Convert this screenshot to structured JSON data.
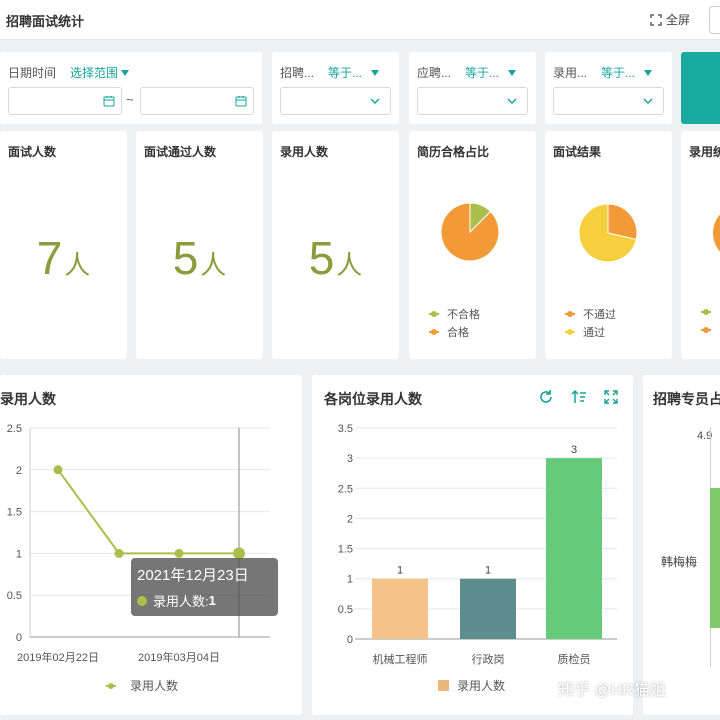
{
  "header": {
    "title": "招聘面试统计",
    "fullscreen_label": "全屏"
  },
  "filters": {
    "date": {
      "label": "日期时间",
      "mode": "选择范围",
      "separator": "~"
    },
    "recruiter": {
      "label": "招聘...",
      "operator": "等于..."
    },
    "applicant": {
      "label": "应聘...",
      "operator": "等于..."
    },
    "hire": {
      "label": "录用...",
      "operator": "等于..."
    }
  },
  "stats": [
    {
      "title": "面试人数",
      "value": "7",
      "unit": "人"
    },
    {
      "title": "面试通过人数",
      "value": "5",
      "unit": "人"
    },
    {
      "title": "录用人数",
      "value": "5",
      "unit": "人"
    }
  ],
  "pie_cards": [
    {
      "title": "简历合格占比",
      "legend": [
        "不合格",
        "合格"
      ]
    },
    {
      "title": "面试结果",
      "legend": [
        "不通过",
        "通过"
      ]
    },
    {
      "title": "录用统"
    }
  ],
  "colors": {
    "accent": "#17a398",
    "green_line": "#a9bf4a",
    "orange": "#f29a38",
    "yellow": "#f6cf3f",
    "bar_green": "#67c97a",
    "bar_teal": "#5d8e8d",
    "bar_peach": "#f5c28a"
  },
  "line_card": {
    "title": "录用人数",
    "legend": "录用人数"
  },
  "tooltip": {
    "date": "2021年12月23日",
    "series": "录用人数:",
    "value": "1"
  },
  "bar_card": {
    "title": "各岗位录用人数",
    "legend": "录用人数"
  },
  "side_card": {
    "title": "招聘专员占",
    "value_label": "4.9",
    "person": "韩梅梅"
  },
  "watermark": "知乎 @HR猫姐",
  "chart_data": [
    {
      "type": "pie",
      "title": "简历合格占比",
      "labels": [
        "不合格",
        "合格"
      ],
      "values": [
        1,
        7
      ]
    },
    {
      "type": "pie",
      "title": "面试结果",
      "labels": [
        "不通过",
        "通过"
      ],
      "values": [
        2,
        5
      ]
    },
    {
      "type": "line",
      "title": "录用人数",
      "x_ticks": [
        "2019年02月22日",
        "2019年03月04日"
      ],
      "points": [
        2,
        1,
        1,
        1
      ],
      "ylim": [
        0,
        2.5
      ],
      "y_ticks": [
        "0",
        "0.5",
        "1",
        "1.5",
        "2",
        "2.5"
      ],
      "series": [
        {
          "name": "录用人数",
          "values": [
            2,
            1,
            1,
            1
          ]
        }
      ]
    },
    {
      "type": "bar",
      "title": "各岗位录用人数",
      "categories": [
        "机械工程师",
        "行政岗",
        "质检员"
      ],
      "values": [
        1,
        1,
        3
      ],
      "ylim": [
        0,
        3.5
      ],
      "y_ticks": [
        "0",
        "0.5",
        "1",
        "1.5",
        "2",
        "2.5",
        "3",
        "3.5"
      ],
      "series": [
        {
          "name": "录用人数",
          "values": [
            1,
            1,
            3
          ]
        }
      ]
    }
  ]
}
